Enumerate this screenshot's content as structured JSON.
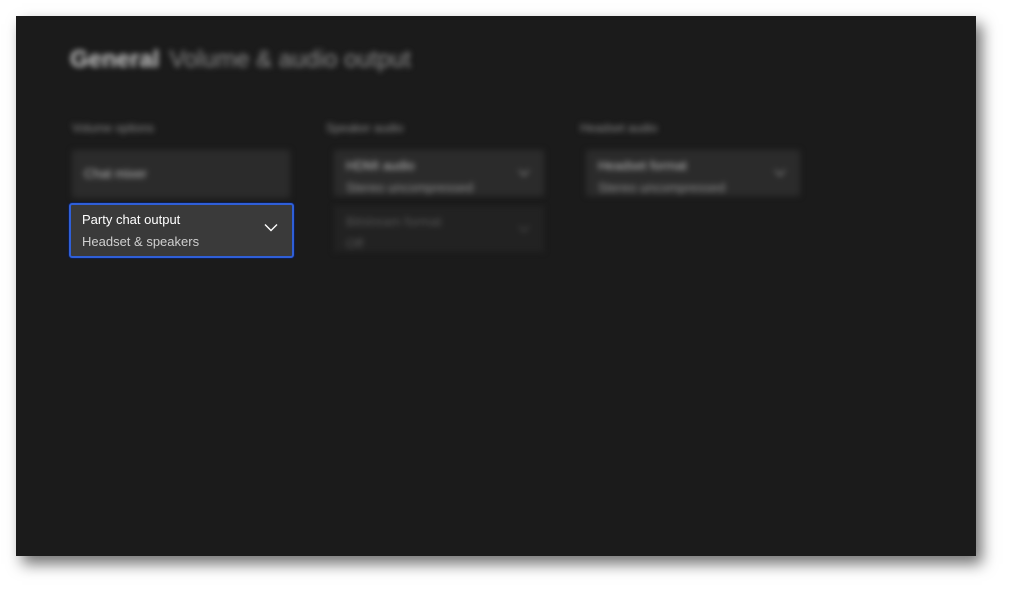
{
  "header": {
    "section": "General",
    "title": "Volume & audio output"
  },
  "columns": {
    "volume": {
      "label": "Volume options",
      "items": [
        {
          "label": "Chat mixer"
        }
      ]
    },
    "speaker": {
      "label": "Speaker audio",
      "items": [
        {
          "label": "HDMI audio",
          "value": "Stereo uncompressed"
        },
        {
          "label": "Bitstream format",
          "value": "Off"
        }
      ]
    },
    "headset": {
      "label": "Headset audio",
      "items": [
        {
          "label": "Headset format",
          "value": "Stereo uncompressed"
        }
      ]
    }
  },
  "focused": {
    "label": "Party chat output",
    "value": "Headset & speakers"
  },
  "colors": {
    "background": "#1b1b1b",
    "tile": "#2b2b2b",
    "focused_tile": "#3a3a3a",
    "focus_border": "#2f5fd8"
  },
  "icons": {
    "dropdown": "chevron-down-icon"
  }
}
